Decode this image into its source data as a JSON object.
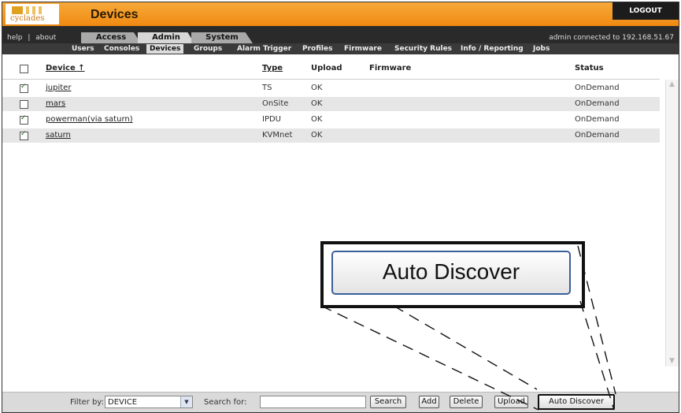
{
  "header": {
    "logo_text": "cyclades",
    "page_title": "Devices",
    "logout_label": "LOGOUT"
  },
  "nav": {
    "help_label": "help",
    "about_label": "about",
    "tabs": [
      {
        "label": "Access"
      },
      {
        "label": "Admin"
      },
      {
        "label": "System"
      }
    ],
    "active_tab": "Admin",
    "connection_status": "admin connected to 192.168.51.67"
  },
  "subnav": {
    "items": [
      {
        "label": "Users"
      },
      {
        "label": "Consoles"
      },
      {
        "label": "Devices"
      },
      {
        "label": "Groups"
      },
      {
        "label": "Alarm Trigger"
      },
      {
        "label": "Profiles"
      },
      {
        "label": "Firmware"
      },
      {
        "label": "Security Rules"
      },
      {
        "label": "Info / Reporting"
      },
      {
        "label": "Jobs"
      }
    ],
    "active": "Devices"
  },
  "table": {
    "columns": {
      "device": "Device ↑",
      "type": "Type",
      "upload": "Upload",
      "firmware": "Firmware",
      "status": "Status"
    },
    "rows": [
      {
        "device": "jupiter",
        "type": "TS",
        "upload": "OK",
        "firmware": "",
        "status": "OnDemand",
        "checked": true
      },
      {
        "device": "mars",
        "type": "OnSite",
        "upload": "OK",
        "firmware": "",
        "status": "OnDemand",
        "checked": false
      },
      {
        "device": "powerman(via saturn)",
        "type": "IPDU",
        "upload": "OK",
        "firmware": "",
        "status": "OnDemand",
        "checked": true
      },
      {
        "device": "saturn",
        "type": "KVMnet",
        "upload": "OK",
        "firmware": "",
        "status": "OnDemand",
        "checked": true
      }
    ]
  },
  "callout": {
    "label": "Auto Discover"
  },
  "bottom": {
    "filter_label": "Filter by:",
    "filter_value": "DEVICE",
    "search_label": "Search for:",
    "search_value": "",
    "search_button": "Search",
    "add_button": "Add",
    "delete_button": "Delete",
    "upload_button": "Upload",
    "auto_discover_button": "Auto Discover"
  },
  "icons": {
    "dropdown": "chevron-down-icon",
    "scroll_up": "arrow-up-icon",
    "scroll_down": "arrow-down-icon"
  }
}
